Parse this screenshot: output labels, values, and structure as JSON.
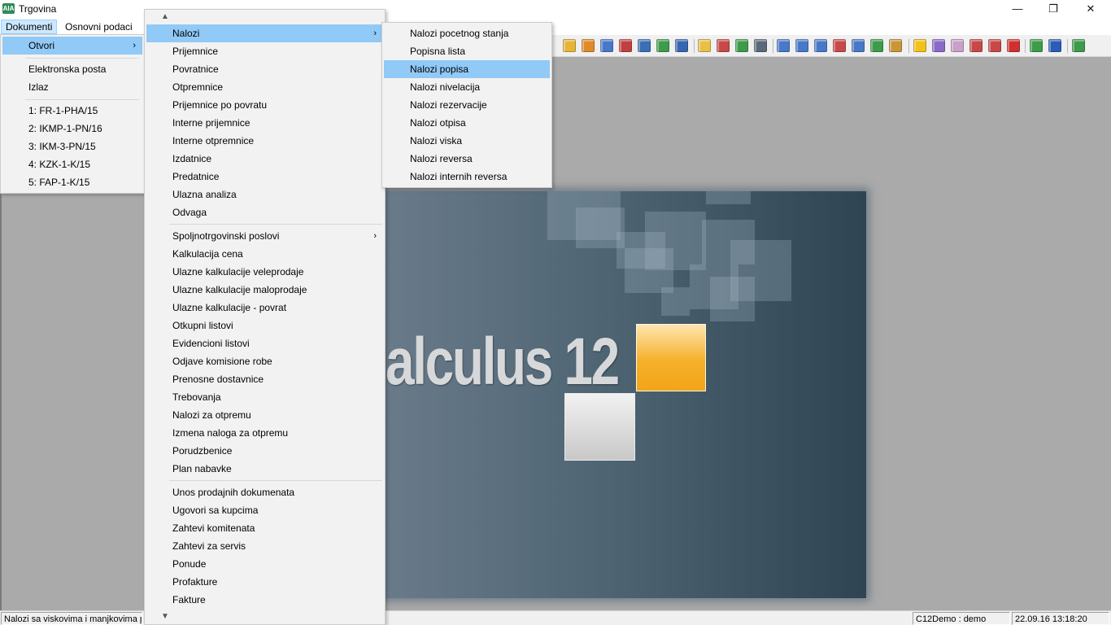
{
  "window": {
    "title": "Trgovina",
    "icon_label": "AIA",
    "minimize": "—",
    "restore": "❐",
    "close": "✕"
  },
  "menubar": {
    "items": [
      "Dokumenti",
      "Osnovni podaci"
    ]
  },
  "dokumenti_menu": {
    "items": [
      "Otvori",
      "Elektronska posta",
      "Izlaz",
      "1: FR-1-PHA/15",
      "2: IKMP-1-PN/16",
      "3: IKM-3-PN/15",
      "4: KZK-1-K/15",
      "5: FAP-1-K/15"
    ]
  },
  "otvori_menu": {
    "items": [
      "Nalozi",
      "Prijemnice",
      "Povratnice",
      "Otpremnice",
      "Prijemnice po povratu",
      "Interne prijemnice",
      "Interne otpremnice",
      "Izdatnice",
      "Predatnice",
      "Ulazna analiza",
      "Odvaga",
      "Spoljnotrgovinski poslovi",
      "Kalkulacija cena",
      "Ulazne kalkulacije veleprodaje",
      "Ulazne kalkulacije maloprodaje",
      "Ulazne kalkulacije - povrat",
      "Otkupni listovi",
      "Evidencioni listovi",
      "Odjave komisione robe",
      "Prenosne dostavnice",
      "Trebovanja",
      "Nalozi za otpremu",
      "Izmena naloga za otpremu",
      "Porudzbenice",
      "Plan nabavke",
      "Unos prodajnih dokumenata",
      "Ugovori sa kupcima",
      "Zahtevi komitenata",
      "Zahtevi za servis",
      "Ponude",
      "Profakture",
      "Fakture"
    ],
    "scroll_up": "▲",
    "scroll_down": "▼"
  },
  "nalozi_menu": {
    "items": [
      "Nalozi pocetnog stanja",
      "Popisna lista",
      "Nalozi popisa",
      "Nalozi nivelacija",
      "Nalozi rezervacije",
      "Nalozi otpisa",
      "Nalozi viska",
      "Nalozi reversa",
      "Nalozi internih reversa"
    ],
    "highlighted": "Nalozi popisa"
  },
  "splash": {
    "text": "alculus 12"
  },
  "statusbar": {
    "hint": "Nalozi sa viskovima i manjkovima po",
    "user": "C12Demo : demo",
    "datetime": "22.09.16 13:18:20"
  },
  "toolbar": {
    "icons": [
      "mail-icon",
      "edit-icon",
      "new-doc-icon",
      "delete-doc-icon",
      "save-icon",
      "export-icon",
      "edit-list-icon",
      "folder-icon",
      "inbox-icon",
      "exchange-icon",
      "calendar-icon",
      "window-icon",
      "layout-icon",
      "copy-icon",
      "print-icon",
      "preview-icon",
      "stats-icon",
      "archive-icon",
      "bulb-icon",
      "settings-icon",
      "tag-icon",
      "calc-icon",
      "currency-icon",
      "heart-icon",
      "refresh-icon",
      "help-icon",
      "exit-icon"
    ],
    "colors": [
      "#e6b437",
      "#e08a2a",
      "#4a78c8",
      "#c04040",
      "#3a6fb5",
      "#3d9b4a",
      "#3566b0",
      "#e8c048",
      "#c84848",
      "#3d9b4a",
      "#5a6a7a",
      "#4a78c8",
      "#4a78c8",
      "#4a78c8",
      "#c84848",
      "#4a78c8",
      "#3d9b4a",
      "#c89638",
      "#f2c21a",
      "#8a6ac8",
      "#c8a0c8",
      "#c84848",
      "#c84848",
      "#d03030",
      "#3d9b4a",
      "#2a5cb8",
      "#3d9b4a"
    ]
  }
}
